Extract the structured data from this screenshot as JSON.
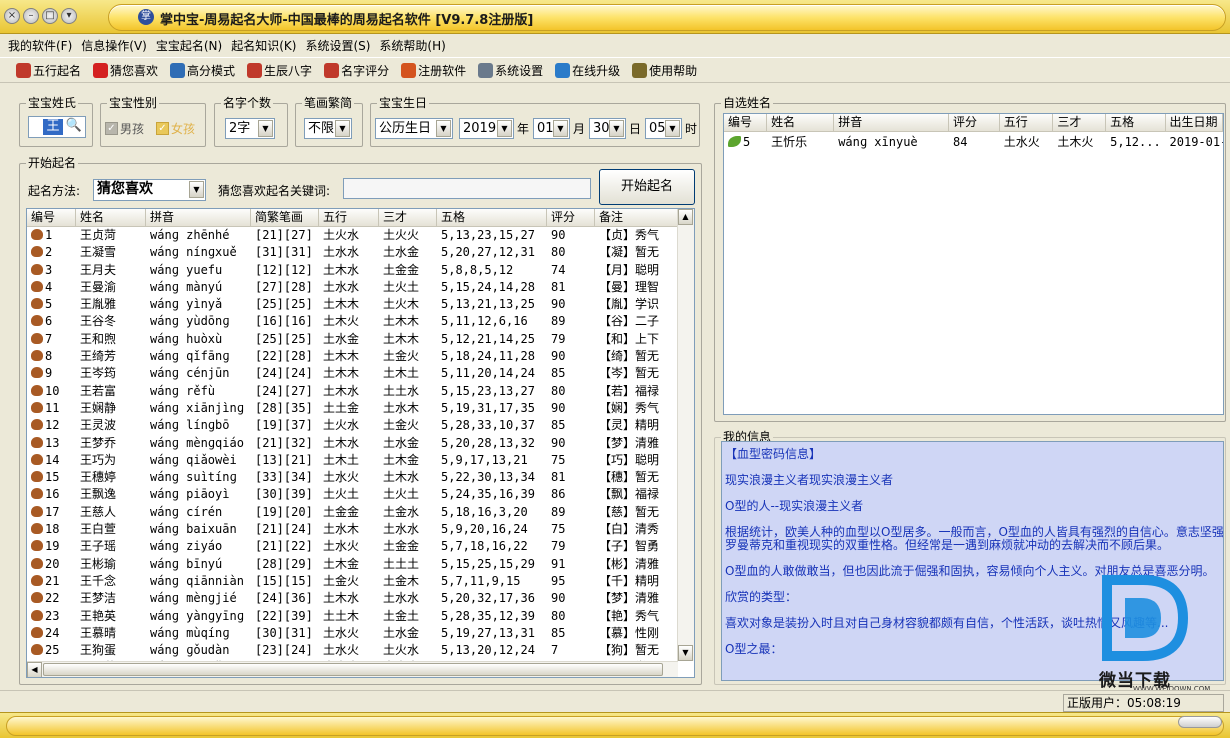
{
  "window": {
    "title": "掌中宝-周易起名大师-中国最棒的周易起名软件 [V9.7.8注册版]"
  },
  "menu": [
    "我的软件(F)",
    "信息操作(V)",
    "宝宝起名(N)",
    "起名知识(K)",
    "系统设置(S)",
    "系统帮助(H)"
  ],
  "toolbar": [
    {
      "label": "五行起名",
      "icon": "wuxing-icon",
      "color": "#c0392b"
    },
    {
      "label": "猜您喜欢",
      "icon": "star-icon",
      "color": "#d42020"
    },
    {
      "label": "高分模式",
      "icon": "chart-icon",
      "color": "#2f6db5"
    },
    {
      "label": "生辰八字",
      "icon": "calendar-icon",
      "color": "#c0392b"
    },
    {
      "label": "名字评分",
      "icon": "score-icon",
      "color": "#c0392b"
    },
    {
      "label": "注册软件",
      "icon": "gift-icon",
      "color": "#d4541f"
    },
    {
      "label": "系统设置",
      "icon": "settings-icon",
      "color": "#6a7a8c"
    },
    {
      "label": "在线升级",
      "icon": "globe-icon",
      "color": "#2a7bc9"
    },
    {
      "label": "使用帮助",
      "icon": "help-icon",
      "color": "#7a6a2a"
    }
  ],
  "form": {
    "surname_label": "宝宝姓氏",
    "surname_value": "王",
    "gender_label": "宝宝性别",
    "male": "男孩",
    "female": "女孩",
    "count_label": "名字个数",
    "count_value": "2字",
    "stroke_label": "笔画繁简",
    "stroke_value": "不限",
    "birth_label": "宝宝生日",
    "calendar_value": "公历生日",
    "year": "2019",
    "year_unit": "年",
    "month": "01",
    "month_unit": "月",
    "day": "30",
    "day_unit": "日",
    "hour": "05",
    "hour_unit": "时"
  },
  "start": {
    "group_label": "开始起名",
    "method_label": "起名方法:",
    "method_value": "猜您喜欢",
    "keyword_label": "猜您喜欢起名关键词:",
    "keyword_value": "",
    "button_label": "开始起名"
  },
  "names_table": {
    "headers": [
      "编号",
      "姓名",
      "拼音",
      "简繁笔画",
      "五行",
      "三才",
      "五格",
      "评分",
      "备注"
    ],
    "rows": [
      [
        "1",
        "王贞菏",
        "wánɡ zhēnhé",
        "[21][27]",
        "土火水",
        "土火火",
        "5,13,23,15,27",
        "90",
        "【贞】秀气"
      ],
      [
        "2",
        "王凝雪",
        "wánɡ nínɡxuě",
        "[31][31]",
        "土水水",
        "土水金",
        "5,20,27,12,31",
        "80",
        "【凝】暂无"
      ],
      [
        "3",
        "王月夫",
        "wánɡ yuefu",
        "[12][12]",
        "土木水",
        "土金金",
        "5,8,8,5,12",
        "74",
        "【月】聪明"
      ],
      [
        "4",
        "王曼渝",
        "wánɡ mànyú",
        "[27][28]",
        "土水水",
        "土火土",
        "5,15,24,14,28",
        "81",
        "【曼】理智"
      ],
      [
        "5",
        "王胤雅",
        "wánɡ yìnyǎ",
        "[25][25]",
        "土木木",
        "土火木",
        "5,13,21,13,25",
        "90",
        "【胤】学识"
      ],
      [
        "6",
        "王谷冬",
        "wánɡ yùdōnɡ",
        "[16][16]",
        "土木火",
        "土木木",
        "5,11,12,6,16",
        "89",
        "【谷】二子"
      ],
      [
        "7",
        "王和煦",
        "wánɡ huòxù",
        "[25][25]",
        "土水金",
        "土木木",
        "5,12,21,14,25",
        "79",
        "【和】上下"
      ],
      [
        "8",
        "王绮芳",
        "wánɡ qǐfānɡ",
        "[22][28]",
        "土木木",
        "土金火",
        "5,18,24,11,28",
        "90",
        "【绮】暂无"
      ],
      [
        "9",
        "王岑筠",
        "wánɡ cénjūn",
        "[24][24]",
        "土木木",
        "土木土",
        "5,11,20,14,24",
        "85",
        "【岑】暂无"
      ],
      [
        "10",
        "王若富",
        "wánɡ rěfù",
        "[24][27]",
        "土木水",
        "土土水",
        "5,15,23,13,27",
        "80",
        "【若】福禄"
      ],
      [
        "11",
        "王娴静",
        "wánɡ xiānjìnɡ",
        "[28][35]",
        "土土金",
        "土水木",
        "5,19,31,17,35",
        "90",
        "【娴】秀气"
      ],
      [
        "12",
        "王灵波",
        "wánɡ línɡbō",
        "[19][37]",
        "土火水",
        "土金火",
        "5,28,33,10,37",
        "85",
        "【灵】精明"
      ],
      [
        "13",
        "王梦乔",
        "wánɡ mènɡqiáo",
        "[21][32]",
        "土木水",
        "土水金",
        "5,20,28,13,32",
        "90",
        "【梦】清雅"
      ],
      [
        "14",
        "王巧为",
        "wánɡ qiǎowèi",
        "[13][21]",
        "土木土",
        "土木金",
        "5,9,17,13,21",
        "75",
        "【巧】聪明"
      ],
      [
        "15",
        "王穗婷",
        "wánɡ suìtínɡ",
        "[33][34]",
        "土水火",
        "土木水",
        "5,22,30,13,34",
        "81",
        "【穗】暂无"
      ],
      [
        "16",
        "王飘逸",
        "wánɡ piāoyì",
        "[30][39]",
        "土火土",
        "土火土",
        "5,24,35,16,39",
        "86",
        "【飘】福禄"
      ],
      [
        "17",
        "王慈人",
        "wánɡ círén",
        "[19][20]",
        "土金金",
        "土金水",
        "5,18,16,3,20",
        "89",
        "【慈】暂无"
      ],
      [
        "18",
        "王白萱",
        "wánɡ baixuān",
        "[21][24]",
        "土水木",
        "土水水",
        "5,9,20,16,24",
        "75",
        "【白】清秀"
      ],
      [
        "19",
        "王子瑶",
        "wánɡ ziyáo",
        "[21][22]",
        "土水火",
        "土金金",
        "5,7,18,16,22",
        "79",
        "【子】智勇"
      ],
      [
        "20",
        "王彬瑜",
        "wánɡ bīnyú",
        "[28][29]",
        "土木金",
        "土土土",
        "5,15,25,15,29",
        "91",
        "【彬】清雅"
      ],
      [
        "21",
        "王千念",
        "wánɡ qiānniàn",
        "[15][15]",
        "土金火",
        "土金木",
        "5,7,11,9,15",
        "95",
        "【千】精明"
      ],
      [
        "22",
        "王梦洁",
        "wánɡ mènɡjié",
        "[24][36]",
        "土木水",
        "土水水",
        "5,20,32,17,36",
        "90",
        "【梦】清雅"
      ],
      [
        "23",
        "王艳英",
        "wánɡ yànɡyīnɡ",
        "[22][39]",
        "土土木",
        "土金土",
        "5,28,35,12,39",
        "80",
        "【艳】秀气"
      ],
      [
        "24",
        "王慕晴",
        "wánɡ mùqínɡ",
        "[30][31]",
        "土水火",
        "土水金",
        "5,19,27,13,31",
        "85",
        "【慕】性刚"
      ],
      [
        "25",
        "王狗蛋",
        "wánɡ ɡǒudàn",
        "[23][24]",
        "土水火",
        "土火水",
        "5,13,20,12,24",
        "7",
        "【狗】暂无"
      ],
      [
        "26",
        "王闻蔓",
        "wánɡ wēnyǔ",
        "[23][25]",
        "土木木",
        "土木木",
        "5,13,21,13,25",
        "89",
        "【闻】学识"
      ]
    ]
  },
  "selected": {
    "group_label": "自选姓名",
    "headers": [
      "编号",
      "姓名",
      "拼音",
      "评分",
      "五行",
      "三才",
      "五格",
      "出生日期"
    ],
    "rows": [
      [
        "5",
        "王忻乐",
        "wánɡ xīnyuè",
        "84",
        "土水火",
        "土木火",
        "5,12...",
        "2019-01-"
      ]
    ]
  },
  "info": {
    "group_label": "我的信息",
    "lines": [
      "【血型密码信息】",
      "现实浪漫主义者现实浪漫主义者",
      "O型的人--现实浪漫主义者",
      "根据统计，欧美人种的血型以O型居多。一般而言，O型血的人皆具有强烈的自信心。意志坚强，",
      "罗曼蒂克和重视现实的双重性格。但经常是一遇到麻烦就冲动的去解决而不顾后果。",
      "O型血的人敢做敢当，但也因此流于倔强和固执，容易倾向个人主义。对朋友总是喜恶分明。",
      "欣赏的类型：",
      "喜欢对象是装扮入时且对自己身材容貌都颇有自信，个性活跃，谈吐热情又风趣等...",
      "O型之最："
    ]
  },
  "status": {
    "text": "正版用户：05:08:19"
  },
  "watermark": {
    "brand": "微当下载",
    "site": "WWW.WEIDOWN.COM"
  },
  "colors": {
    "title_gold": "#f3c42a",
    "info_bg": "#cfd6f5",
    "info_text": "#1733b8",
    "watermark_blue": "#1e8fe0"
  }
}
